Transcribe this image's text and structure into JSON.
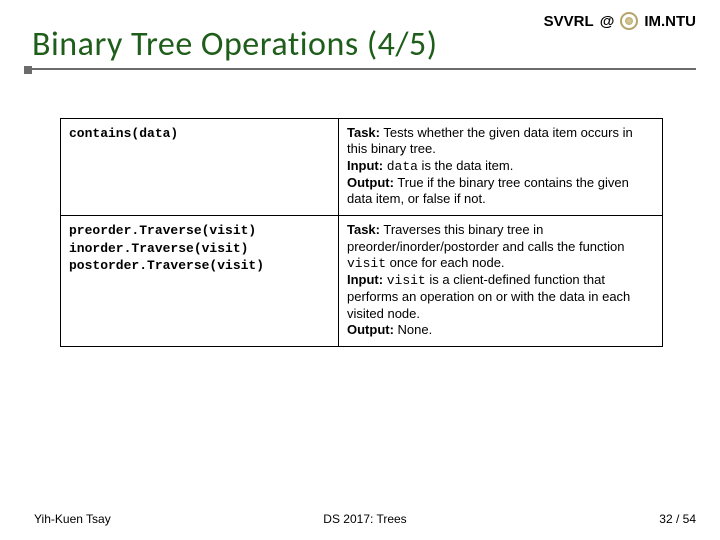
{
  "header": {
    "org_left": "SVVRL",
    "at": "@",
    "org_right": "IM.NTU"
  },
  "title": "Binary Tree Operations (4/5)",
  "table": {
    "rows": [
      {
        "sig": "contains(data)",
        "task": "Tests whether the given data item occurs in this binary tree.",
        "input_pre": "",
        "input_code": "data",
        "input_post": " is the data item.",
        "output": "True if the binary tree contains the given data item, or false if not."
      },
      {
        "sig": "preorder.Traverse(visit)\ninorder.Traverse(visit)\npostorder.Traverse(visit)",
        "task_pre": "Traverses this binary tree in preorder/inorder/postorder and calls the function ",
        "task_code": "visit",
        "task_post": " once for each node.",
        "input_pre": "",
        "input_code": "visit",
        "input_post": " is a client-defined function that performs an operation on or with the data in each visited node.",
        "output": "None."
      }
    ]
  },
  "footer": {
    "author": "Yih-Kuen Tsay",
    "course": "DS 2017: Trees",
    "page_current": "32",
    "page_sep": " / ",
    "page_total": "54"
  }
}
